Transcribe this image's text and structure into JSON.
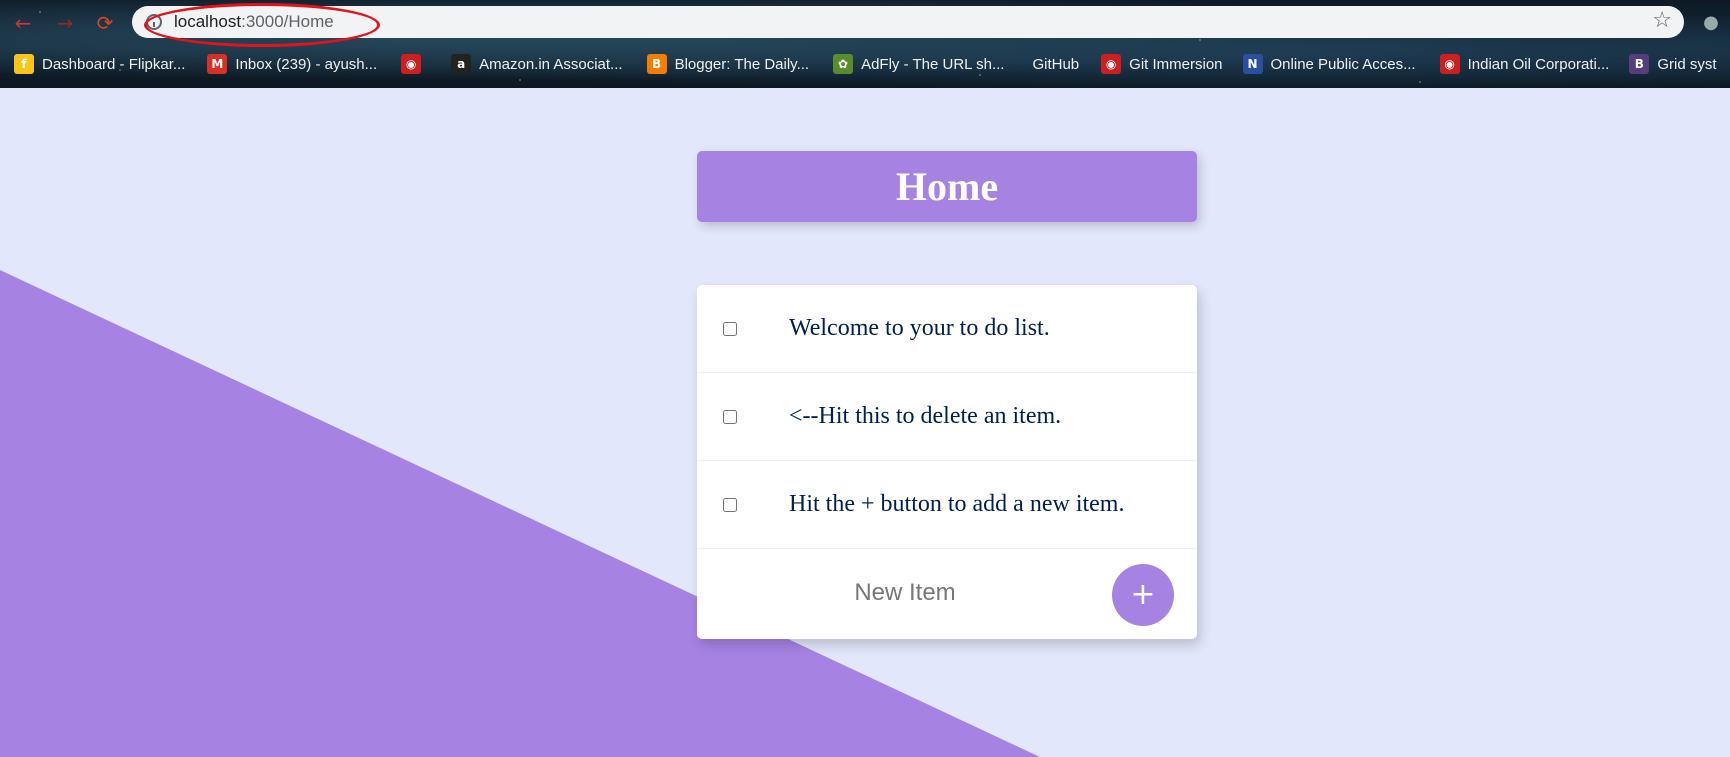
{
  "browser": {
    "nav": {
      "back_icon": "←",
      "forward_icon": "→",
      "reload_icon": "⟳"
    },
    "url": {
      "host": "localhost",
      "port_path": ":3000/Home"
    },
    "star_icon": "☆",
    "profile_icon": "●",
    "annotation_color": "#E3121B",
    "bookmarks": [
      {
        "label": "Dashboard - Flipkar...",
        "icon_text": "f",
        "icon_color": "#F8C51C"
      },
      {
        "label": "Inbox (239) - ayush...",
        "icon_text": "M",
        "icon_color": "#D93025"
      },
      {
        "label": "",
        "icon_text": "◉",
        "icon_color": "#CC1F1F"
      },
      {
        "label": "Amazon.in Associat...",
        "icon_text": "a",
        "icon_color": "#222222"
      },
      {
        "label": "Blogger: The Daily...",
        "icon_text": "B",
        "icon_color": "#F57D00"
      },
      {
        "label": "AdFly - The URL sh...",
        "icon_text": "✿",
        "icon_color": "#5B8C2A"
      },
      {
        "label": "GitHub",
        "icon_text": "",
        "icon_color": "transparent"
      },
      {
        "label": "Git Immersion",
        "icon_text": "◉",
        "icon_color": "#CC1F1F"
      },
      {
        "label": "Online Public Acces...",
        "icon_text": "N",
        "icon_color": "#2B4F9E"
      },
      {
        "label": "Indian Oil Corporati...",
        "icon_text": "◉",
        "icon_color": "#CC1F1F"
      },
      {
        "label": "Grid syst",
        "icon_text": "B",
        "icon_color": "#563D7C"
      }
    ]
  },
  "page": {
    "title": "Home",
    "accent_color": "#A683E3",
    "background_color": "#E2E7FB",
    "items": [
      {
        "text": "Welcome to your to do list."
      },
      {
        "text": "<--Hit this to delete an item."
      },
      {
        "text": "Hit the + button to add a new item."
      }
    ],
    "new_item": {
      "placeholder": "New Item",
      "add_label": "+"
    }
  }
}
